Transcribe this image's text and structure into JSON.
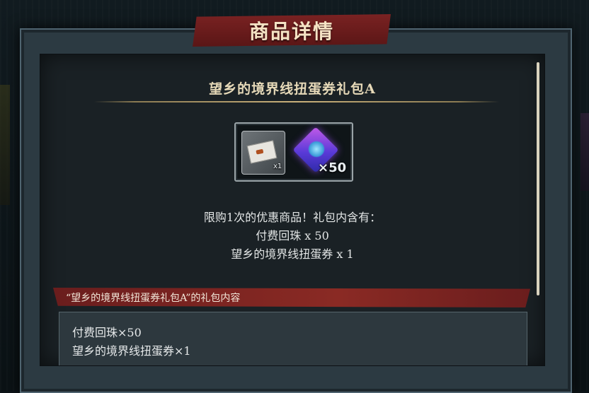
{
  "dialog": {
    "title": "商品详情",
    "product_name": "望乡的境界线扭蛋券礼包A"
  },
  "items": [
    {
      "icon": "gacha-ticket-icon",
      "quantity": "x1"
    },
    {
      "icon": "paid-orb-icon",
      "quantity": "×50"
    }
  ],
  "description": {
    "line1": "限购1次的优惠商品！礼包内含有：",
    "line2": "付费回珠 x 50",
    "line3": "望乡的境界线扭蛋券 x 1"
  },
  "contents_section": {
    "header": "“望乡的境界线扭蛋券礼包A”的礼包内容",
    "lines": [
      "付费回珠×50",
      "望乡的境界线扭蛋券×1"
    ]
  },
  "colors": {
    "banner_red": "#7a2222",
    "panel_bg": "#1a2125",
    "gold_accent": "#c9b07a"
  }
}
